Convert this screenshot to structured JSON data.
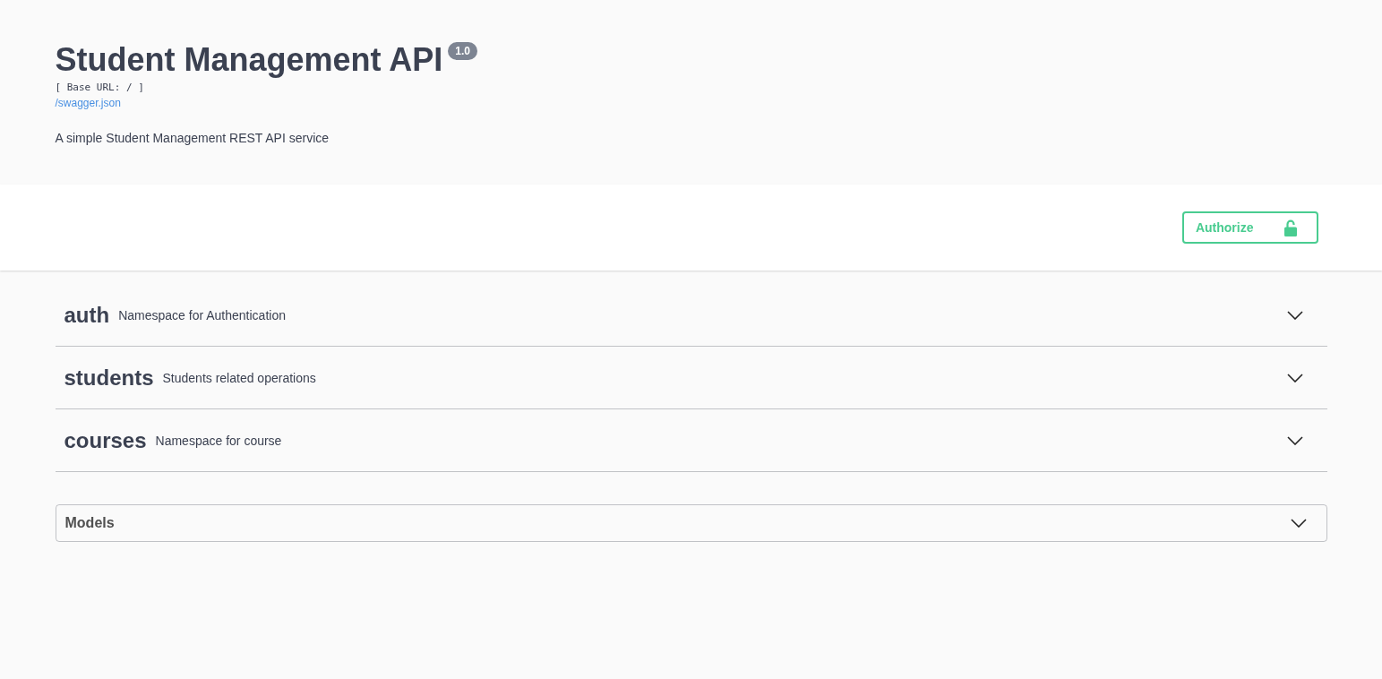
{
  "info": {
    "title": "Student Management API",
    "version": "1.0",
    "base_url": "[ Base URL: / ]",
    "spec_link": "/swagger.json",
    "description": "A simple Student Management REST API service"
  },
  "scheme_bar": {
    "authorize_button": "Authorize"
  },
  "tags": [
    {
      "name": "auth",
      "description": "Namespace for Authentication",
      "expanded": false
    },
    {
      "name": "students",
      "description": "Students related operations",
      "expanded": false
    },
    {
      "name": "courses",
      "description": "Namespace for course",
      "expanded": false
    }
  ],
  "models": {
    "title": "Models",
    "expanded": false
  }
}
